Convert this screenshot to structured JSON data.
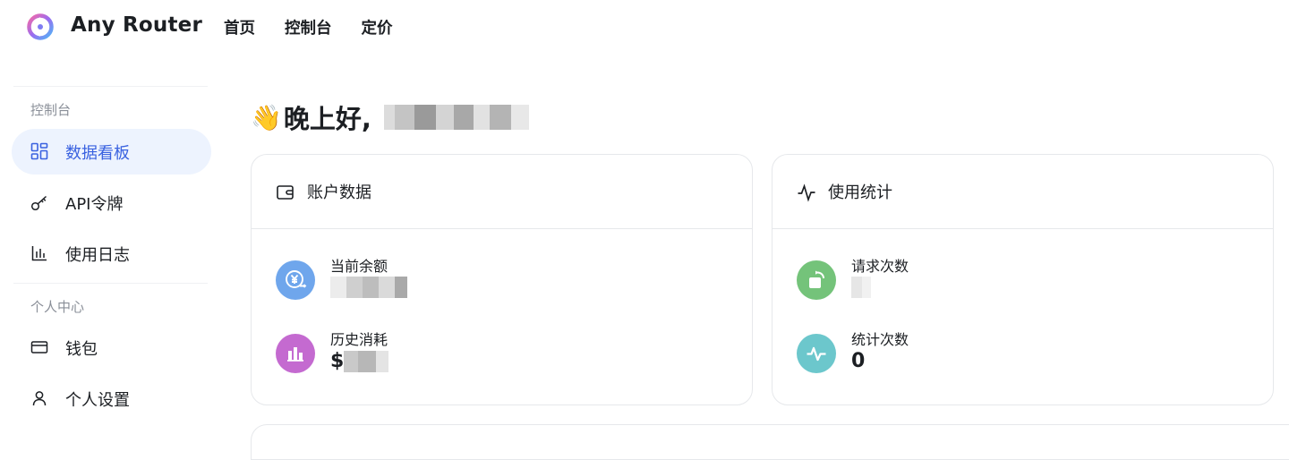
{
  "header": {
    "brand": "Any Router",
    "nav": [
      "首页",
      "控制台",
      "定价"
    ]
  },
  "sidebar": {
    "groups": [
      {
        "title": "控制台",
        "items": [
          {
            "label": "数据看板",
            "icon": "dashboard-icon",
            "active": true
          },
          {
            "label": "API令牌",
            "icon": "key-icon",
            "active": false
          },
          {
            "label": "使用日志",
            "icon": "bar-chart-icon",
            "active": false
          }
        ]
      },
      {
        "title": "个人中心",
        "items": [
          {
            "label": "钱包",
            "icon": "credit-card-icon",
            "active": false
          },
          {
            "label": "个人设置",
            "icon": "user-icon",
            "active": false
          }
        ]
      }
    ]
  },
  "main": {
    "greeting": "晚上好,",
    "greeting_emoji": "👋",
    "account_card": {
      "title": "账户数据",
      "icon": "wallet-icon",
      "stats": [
        {
          "label": "当前余额",
          "value": "",
          "icon": "yen-exchange-icon",
          "color": "#6fa6ec"
        },
        {
          "label": "历史消耗",
          "value": "$",
          "icon": "bar-chart-icon",
          "color": "#c46ad0"
        }
      ]
    },
    "usage_card": {
      "title": "使用统计",
      "icon": "activity-icon",
      "stats": [
        {
          "label": "请求次数",
          "value": "",
          "icon": "rotate-icon",
          "color": "#74c37a"
        },
        {
          "label": "统计次数",
          "value": "0",
          "icon": "pulse-icon",
          "color": "#6cc7cc"
        }
      ]
    }
  },
  "colors": {
    "accent": "#3a62e0",
    "active_bg": "#edf3fe",
    "border": "#e6e8eb"
  }
}
